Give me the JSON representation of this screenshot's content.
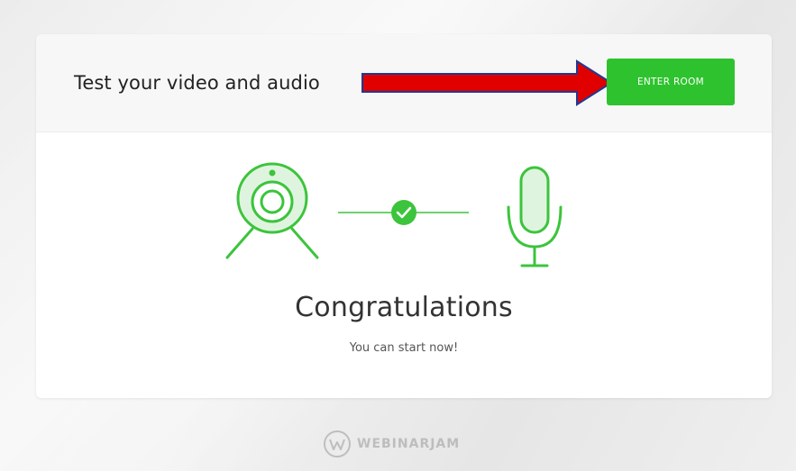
{
  "header": {
    "title": "Test your video and audio",
    "enter_button_label": "ENTER ROOM"
  },
  "status": {
    "headline": "Congratulations",
    "message": "You can start now!"
  },
  "icons": {
    "camera": "webcam-icon",
    "check": "check-circle-icon",
    "microphone": "microphone-icon",
    "annotation_arrow": "red-arrow-annotation"
  },
  "colors": {
    "accent_green": "#2ec32e",
    "icon_green": "#3cc43c",
    "icon_fill": "#dff4df",
    "arrow_red": "#e00000",
    "arrow_outline": "#1f3a93"
  },
  "footer": {
    "brand": "WEBINARJAM"
  }
}
